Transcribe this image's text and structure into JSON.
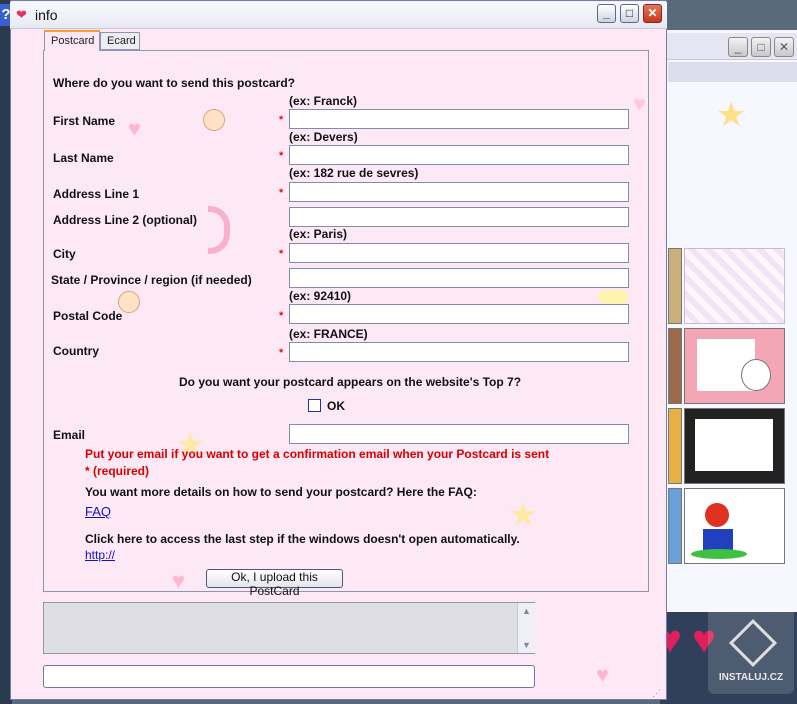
{
  "window": {
    "title": "info",
    "controls": {
      "minimize": "_",
      "maximize": "□",
      "close": "✕"
    }
  },
  "tabs": [
    {
      "label": "Postcard",
      "active": true
    },
    {
      "label": "Ecard",
      "active": false
    }
  ],
  "form": {
    "question": "Where do you want to send this postcard?",
    "required_mark": "*",
    "fields": {
      "first_name": {
        "label": "First Name",
        "hint": "(ex: Franck)"
      },
      "last_name": {
        "label": "Last Name",
        "hint": "(ex: Devers)"
      },
      "address1": {
        "label": "Address Line 1",
        "hint": "(ex: 182 rue de sevres)"
      },
      "address2": {
        "label": "Address Line 2 (optional)"
      },
      "city": {
        "label": "City",
        "hint": "(ex: Paris)"
      },
      "state": {
        "label": "State / Province / region (if needed)"
      },
      "postal_code": {
        "label": "Postal Code",
        "hint": "(ex: 92410)"
      },
      "country": {
        "label": "Country",
        "hint": "(ex: FRANCE)"
      },
      "email": {
        "label": "Email"
      }
    },
    "top7_question": "Do you want your postcard appears on the website's Top 7?",
    "top7_checkbox_label": "OK",
    "email_note": "Put your email if you want to get a confirmation email when your Postcard is sent",
    "required_note": "* (required)",
    "faq_text": "You want more details on how to send your postcard? Here the FAQ:",
    "faq_link": "FAQ",
    "last_step_text": "Click here to access the last step if the windows doesn't open automatically.",
    "last_step_link": "http://",
    "submit_button": "Ok, I upload this PostCard"
  },
  "background": {
    "help_glyph": "?",
    "watermark": "INSTALUJ.CZ",
    "bg_controls": {
      "minimize": "_",
      "maximize": "□",
      "close": "✕"
    }
  },
  "icons": {
    "title": "heart-icon",
    "scroll_up": "▲",
    "scroll_down": "▼",
    "nav_prev": "♥",
    "nav_next": "♥",
    "grip": "⋰"
  },
  "colors": {
    "window_bg": "#fde8f6",
    "required": "#e01010",
    "note": "#d80000",
    "link": "#1010d0",
    "tab_accent": "#f5a030"
  }
}
